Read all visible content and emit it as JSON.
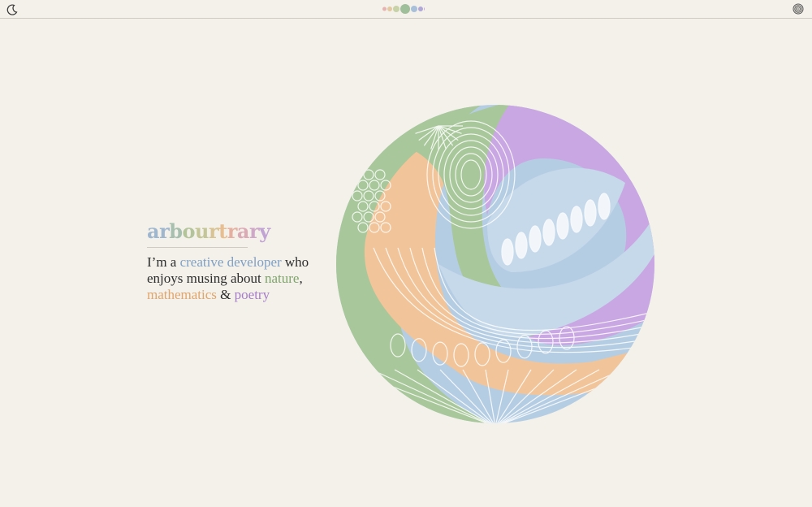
{
  "header": {
    "theme_toggle_icon": "moon-icon",
    "fingerprint_icon": "fingerprint-icon",
    "palette_colors": [
      "#e6b3b0",
      "#e3c8a2",
      "#c8d2a8",
      "#9fbf9a",
      "#a8c0da",
      "#b2a8d8",
      "#c8a8d8"
    ]
  },
  "hero": {
    "title_letters": [
      {
        "ch": "a",
        "color": "#9fb6cf"
      },
      {
        "ch": "r",
        "color": "#9fb6cf"
      },
      {
        "ch": "b",
        "color": "#a6bfae"
      },
      {
        "ch": "o",
        "color": "#b4c49a"
      },
      {
        "ch": "u",
        "color": "#c4c697"
      },
      {
        "ch": "r",
        "color": "#d8c394"
      },
      {
        "ch": "t",
        "color": "#e6be92"
      },
      {
        "ch": "r",
        "color": "#e6b0a0"
      },
      {
        "ch": "a",
        "color": "#dcaab5"
      },
      {
        "ch": "r",
        "color": "#cfa8c8"
      },
      {
        "ch": "y",
        "color": "#c2a4d4"
      }
    ],
    "intro_prefix": "I’m a ",
    "intro_link_1": "creative developer",
    "intro_mid_1": " who enjoys musing about ",
    "intro_link_2": "nature",
    "intro_mid_2": ", ",
    "intro_link_3": "mathematics",
    "intro_mid_3": " & ",
    "intro_link_4": "poetry",
    "colors": {
      "creative": "#7f9fc4",
      "nature": "#7fa36c",
      "mathematics": "#e0a56c",
      "poetry": "#a47cc8"
    }
  },
  "art": {
    "colors": {
      "green": "#a8c79a",
      "orange": "#f1c499",
      "purple": "#c9a7e3",
      "blue": "#b5cde3",
      "lightblue": "#c6d9ea"
    }
  }
}
